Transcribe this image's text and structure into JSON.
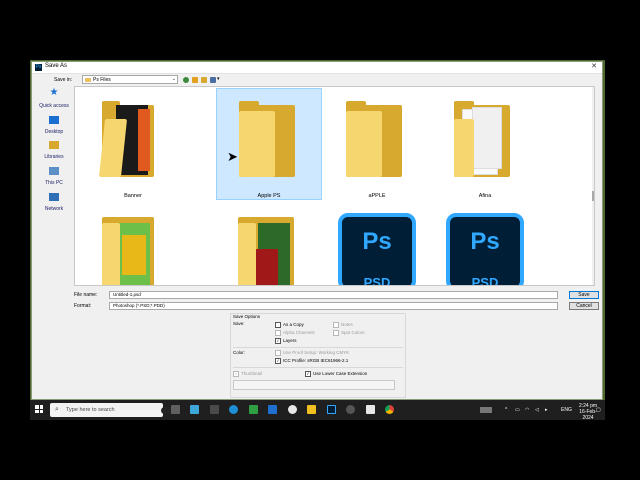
{
  "dialog": {
    "title": "Save As",
    "save_in_label": "Save in:",
    "save_in_value": "Ps Files"
  },
  "places": [
    {
      "label": "Quick access",
      "icon": "star-icon"
    },
    {
      "label": "Desktop",
      "icon": "desktop-icon"
    },
    {
      "label": "Libraries",
      "icon": "library-icon"
    },
    {
      "label": "This PC",
      "icon": "computer-icon"
    },
    {
      "label": "Network",
      "icon": "network-icon"
    }
  ],
  "files": [
    {
      "label": "Banner",
      "type": "folder",
      "selected": false
    },
    {
      "label": "Apple PS",
      "type": "folder",
      "selected": true
    },
    {
      "label": "aPPLE",
      "type": "folder",
      "selected": false
    },
    {
      "label": "Afina",
      "type": "folder",
      "selected": false
    },
    {
      "label": "",
      "type": "folder",
      "selected": false
    },
    {
      "label": "",
      "type": "folder",
      "selected": false
    },
    {
      "label": "",
      "type": "psd",
      "selected": false
    },
    {
      "label": "",
      "type": "psd",
      "selected": false
    }
  ],
  "psd_tile_text": "Ps",
  "psd_tile_subtext": "PSD",
  "file_name_label": "File name:",
  "file_name_value": "Untitled-1.psd",
  "format_label": "Format:",
  "format_value": "Photoshop (*.PSD;*.PDD)",
  "save_button": "Save",
  "cancel_button": "Cancel",
  "options": {
    "heading": "Save Options",
    "save_label": "Save:",
    "as_copy": "As a Copy",
    "alpha_channels": "Alpha Channels",
    "layers": "Layers",
    "notes": "Notes",
    "spot_colors": "Spot Colors",
    "color_label": "Color:",
    "use_proof": "Use Proof Setup:  Working CMYK",
    "icc_profile": "ICC Profile:  sRGB IEC61966-2.1",
    "thumbnail": "Thumbnail",
    "lowercase_ext": "Use Lower Case Extension"
  },
  "taskbar": {
    "search_placeholder": "Type here to search",
    "language": "ENG",
    "time": "2:24 pm",
    "date": "16-Feb-2024"
  },
  "colors": {
    "selection": "#cde8ff",
    "accent_green": "#4e6a2e",
    "ps_blue": "#31a8ff",
    "ps_navy": "#001e36"
  }
}
